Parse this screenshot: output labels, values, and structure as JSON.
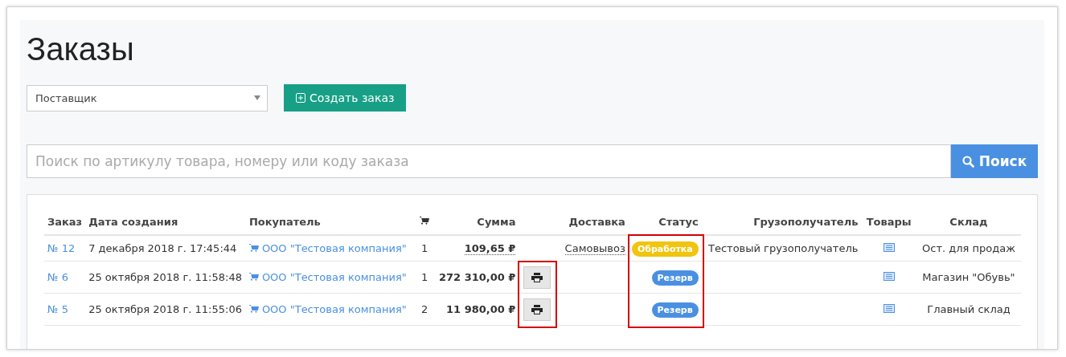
{
  "title": "Заказы",
  "supplier_select": {
    "value": "Поставщик"
  },
  "create_button": {
    "label": "Создать заказ"
  },
  "search": {
    "placeholder": "Поиск по артикулу товара, номеру или коду заказа",
    "button": "Поиск"
  },
  "table": {
    "columns": [
      {
        "kind": "text",
        "label": "Заказ"
      },
      {
        "kind": "text",
        "label": "Дата создания"
      },
      {
        "kind": "text",
        "label": "Покупатель"
      },
      {
        "kind": "cart"
      },
      {
        "kind": "text",
        "label": "Сумма"
      },
      {
        "kind": "blank"
      },
      {
        "kind": "text",
        "label": "Доставка"
      },
      {
        "kind": "text",
        "label": "Статус"
      },
      {
        "kind": "text",
        "label": "Грузополучатель"
      },
      {
        "kind": "text",
        "label": "Товары"
      },
      {
        "kind": "text",
        "label": "Склад"
      }
    ],
    "rows": [
      {
        "number": "№ 12",
        "date": "7 декабря 2018 г. 17:45:44",
        "buyer": "ООО \"Тестовая компания\"",
        "quantity": "1",
        "sum": "109,65 ₽",
        "sum_dotted": true,
        "printable": false,
        "print_marked": false,
        "delivery": "Самовывоз",
        "status": {
          "label": "Обработка",
          "color": "#f1c40f"
        },
        "status_marked": true,
        "consignee": "Тестовый грузополучатель",
        "warehouse": "Ост. для продаж"
      },
      {
        "number": "№ 6",
        "date": "25 октября 2018 г. 11:58:48",
        "buyer": "ООО \"Тестовая компания\"",
        "quantity": "1",
        "sum": "272 310,00 ₽",
        "sum_dotted": false,
        "printable": true,
        "print_marked": true,
        "status": {
          "label": "Резерв",
          "color": "#4a90e2"
        },
        "status_marked": true,
        "warehouse": "Магазин \"Обувь\""
      },
      {
        "number": "№ 5",
        "date": "25 октября 2018 г. 11:55:06",
        "buyer": "ООО \"Тестовая компания\"",
        "quantity": "2",
        "sum": "11 980,00 ₽",
        "sum_dotted": false,
        "printable": true,
        "print_marked": true,
        "status": {
          "label": "Резерв",
          "color": "#4a90e2"
        },
        "status_marked": true,
        "warehouse": "Главный склад"
      }
    ]
  }
}
